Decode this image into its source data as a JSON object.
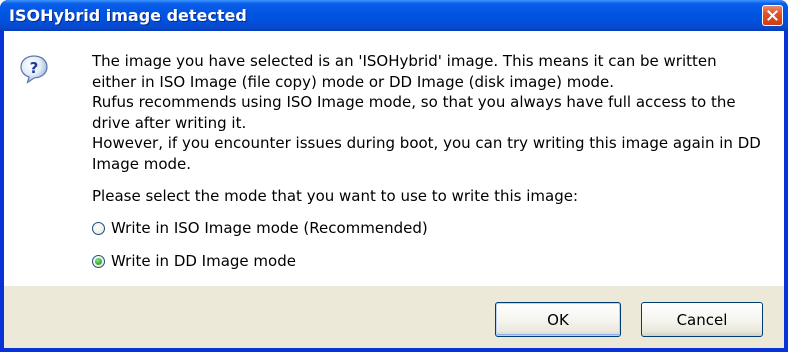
{
  "window": {
    "title": "ISOHybrid image detected"
  },
  "message": {
    "lines": [
      "The image you have selected is an 'ISOHybrid' image. This means it can be written either in ISO Image (file copy) mode or DD Image (disk image) mode.",
      "Rufus recommends using ISO Image mode, so that you always have full access to the drive after writing it.",
      "However, if you encounter issues during boot, you can try writing this image again in DD Image mode."
    ],
    "prompt": "Please select the mode that you want to use to write this image:"
  },
  "options": [
    {
      "label": "Write in ISO Image mode (Recommended)",
      "selected": false
    },
    {
      "label": "Write in DD Image mode",
      "selected": true
    }
  ],
  "buttons": {
    "ok": "OK",
    "cancel": "Cancel"
  },
  "icons": {
    "dialog": "question-icon",
    "close": "close-icon"
  },
  "colors": {
    "titlebar": "#0054e3",
    "client": "#ece9d8",
    "radio_checked": "#21a121"
  }
}
